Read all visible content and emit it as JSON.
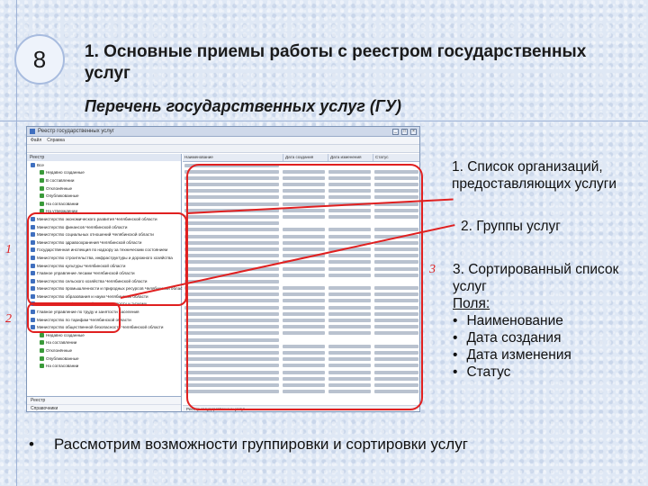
{
  "slide": {
    "number": "8",
    "title": "1. Основные приемы работы с реестром государственных услуг",
    "subtitle": "Перечень государственных услуг (ГУ)"
  },
  "app": {
    "window_title": "Реестр государственных услуг",
    "menu": [
      "Файл",
      "Справка"
    ],
    "left_header": "Реестр",
    "tree_groups": [
      "Все",
      "Недавно созданные",
      "В составлении",
      "Отклонённые",
      "Опубликованные",
      "На согласовании",
      "На утверждении",
      "Министерство экономического развития Челябинской области",
      "Министерство финансов Челябинской области",
      "Министерство социальных отношений Челябинской области",
      "Министерство здравоохранения Челябинской области",
      "Государственная инспекция по надзору за техническим состоянием",
      "Министерство строительства, инфраструктуры и дорожного хозяйства",
      "Министерство культуры Челябинской области",
      "Главное управление лесами Челябинской области",
      "Министерство сельского хозяйства Челябинской области",
      "Министерство промышленности и природных ресурсов Челябинской области",
      "Министерство образования и науки Челябинской области",
      "Министерство по физической культуре, спорту и туризму",
      "Главное управление по труду и занятости населения",
      "Министерство по тарифам Челябинской области",
      "Министерство общественной безопасности Челябинской области"
    ],
    "tree_sub": [
      "Недавно созданные",
      "На составлении",
      "Отклонённые",
      "Опубликованные",
      "На согласовании"
    ],
    "left_bottom": [
      "Реестр",
      "Справочники"
    ],
    "columns": [
      "Наименование",
      "Дата создания",
      "Дата изменения",
      "Статус"
    ],
    "status_text": "Реестр государственных услуг"
  },
  "callouts": {
    "n1": "1",
    "n2": "2",
    "n3": "3",
    "item1": "1. Список организаций, предоставляющих услуги",
    "item2": "2. Группы услуг",
    "item3": "3. Сортированный список услуг",
    "fields_label": "Поля:",
    "fields": [
      "Наименование",
      "Дата создания",
      "Дата изменения",
      "Статус"
    ],
    "bullet": "•"
  },
  "footer": {
    "bullet": "•",
    "text": "Рассмотрим возможности группировки и сортировки услуг"
  },
  "colors": {
    "highlight": "#e02020",
    "icon_green": "#3a9a3a",
    "icon_blue": "#3f6fbf"
  }
}
